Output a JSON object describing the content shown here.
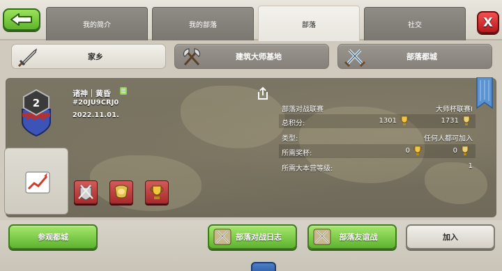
{
  "tabs": [
    {
      "label": "我的简介",
      "active": false
    },
    {
      "label": "我的部落",
      "active": false
    },
    {
      "label": "部落",
      "active": true
    },
    {
      "label": "社交",
      "active": false
    }
  ],
  "close_label": "X",
  "subtabs": [
    {
      "label": "家乡",
      "icon": "sword-icon",
      "active": true
    },
    {
      "label": "建筑大师基地",
      "icon": "crossed-axes-icon",
      "active": false
    },
    {
      "label": "部落都城",
      "icon": "crossed-swords-icon",
      "active": false
    }
  ],
  "clan": {
    "level": "2",
    "name": "诸神｜黄昏",
    "tag": "#20JU9CRJ0",
    "date": "2022.11.01."
  },
  "info": {
    "war_league_label": "部落对战联赛",
    "war_league_value": "大师杯联赛I",
    "total_points_label": "总积分:",
    "total_points_home": "1301",
    "total_points_builder": "1731",
    "type_label": "类型:",
    "type_value": "任何人都可加入",
    "required_trophies_label": "所需奖杯:",
    "required_trophies_home": "0",
    "required_trophies_builder": "0",
    "required_th_label": "所需大本营等级:",
    "required_th_value": "1"
  },
  "bottom": {
    "visit_capital": "参观都城",
    "war_log": "部落对战日志",
    "friendly_war": "部落友谊战",
    "join": "加入"
  },
  "colors": {
    "accent_green": "#5db32f",
    "close_red": "#c0201f",
    "panel_bg": "#746e5e"
  }
}
